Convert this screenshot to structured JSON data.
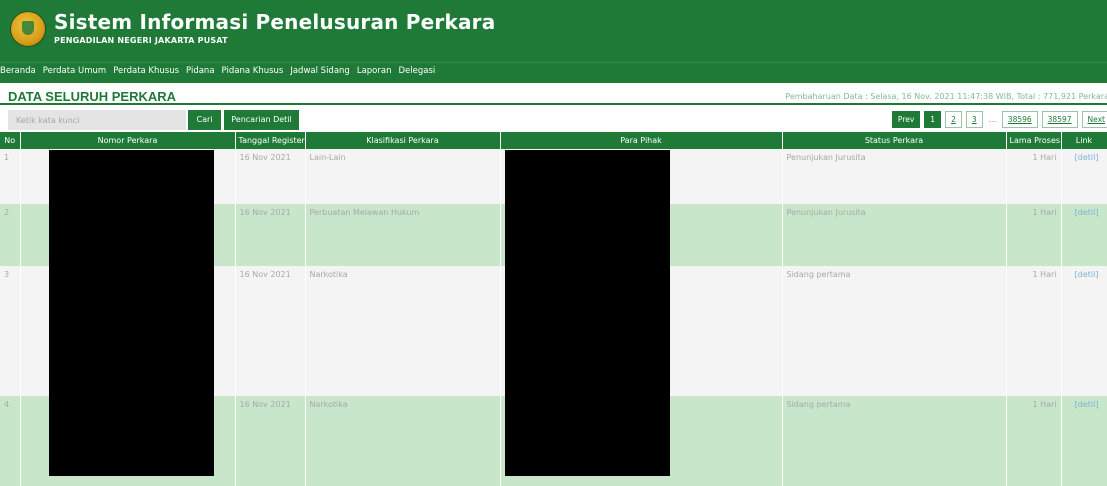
{
  "header": {
    "title": "Sistem Informasi Penelusuran Perkara",
    "subtitle": "PENGADILAN NEGERI JAKARTA PUSAT",
    "logo_icon": "court-emblem-icon"
  },
  "nav": {
    "items": [
      "Beranda",
      "Perdata Umum",
      "Perdata Khusus",
      "Pidana",
      "Pidana Khusus",
      "Jadwal Sidang",
      "Laporan",
      "Delegasi"
    ]
  },
  "section": {
    "title": "DATA SELURUH PERKARA",
    "update_info": "Pembaharuan Data : Selasa, 16 Nov. 2021 11:47:38 WIB, Total : 771,921 Perkara"
  },
  "search": {
    "placeholder": "Ketik kata kunci",
    "value": "",
    "cari_label": "Cari",
    "detil_label": "Pencarian Detil"
  },
  "pagination": {
    "prev": "Prev",
    "pages": [
      "1",
      "2",
      "3"
    ],
    "ellipsis": "...",
    "last_pages": [
      "38596",
      "38597"
    ],
    "next": "Next",
    "current": "1"
  },
  "table": {
    "columns": [
      "No",
      "Nomor Perkara",
      "Tanggal Register",
      "Klasifikasi Perkara",
      "Para Pihak",
      "Status Perkara",
      "Lama Proses",
      "Link"
    ],
    "rows": [
      {
        "no": "1",
        "nomor": "",
        "tanggal": "16 Nov 2021",
        "klasifikasi": "Lain-Lain",
        "pihak": "",
        "status": "Penunjukan Jurusita",
        "lama": "1 Hari",
        "link": "[detil]"
      },
      {
        "no": "2",
        "nomor": "",
        "tanggal": "16 Nov 2021",
        "klasifikasi": "Perbuatan Melawan Hukum",
        "pihak": "",
        "status": "Penunjukan Jurusita",
        "lama": "1 Hari",
        "link": "[detil]"
      },
      {
        "no": "3",
        "nomor": "",
        "tanggal": "16 Nov 2021",
        "klasifikasi": "Narkotika",
        "pihak": "",
        "status": "Sidang pertama",
        "lama": "1 Hari",
        "link": "[detil]"
      },
      {
        "no": "4",
        "nomor": "",
        "tanggal": "16 Nov 2021",
        "klasifikasi": "Narkotika",
        "pihak": "",
        "status": "Sidang pertama",
        "lama": "1 Hari",
        "link": "[detil]"
      }
    ]
  },
  "colors": {
    "primary": "#1f7a38",
    "row_odd": "#f4f4f4",
    "row_even": "#c8e6c9",
    "link": "#7ab3d6",
    "redaction": "#000000"
  }
}
